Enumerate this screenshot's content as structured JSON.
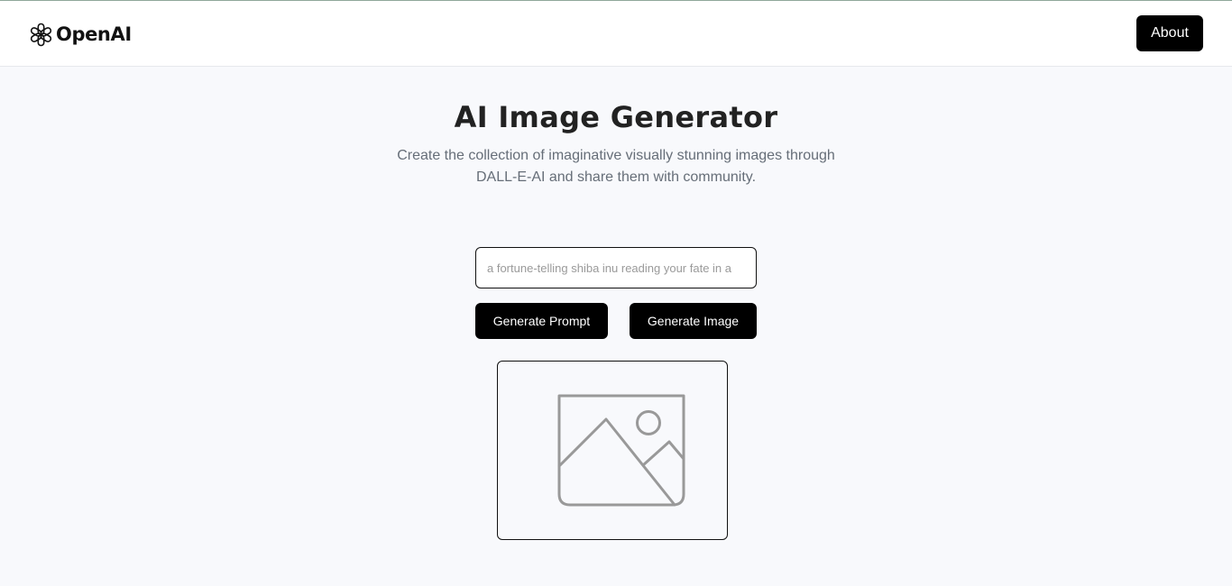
{
  "header": {
    "brand": "OpenAI",
    "brand_icon": "openai-logo-icon",
    "about_label": "About"
  },
  "main": {
    "title": "AI Image Generator",
    "subtitle": "Create the collection of imaginative visually stunning images through DALL-E-AI and share them with community.",
    "prompt": {
      "value": "",
      "placeholder": "a fortune-telling shiba inu reading your fate in a"
    },
    "generate_prompt_label": "Generate Prompt",
    "generate_image_label": "Generate Image",
    "preview_icon": "image-placeholder-icon"
  },
  "colors": {
    "background": "#f8f9fc",
    "header_background": "#ffffff",
    "button_background": "#000000",
    "button_text": "#ffffff",
    "subtitle_text": "#666e78",
    "placeholder_icon": "#999999"
  }
}
